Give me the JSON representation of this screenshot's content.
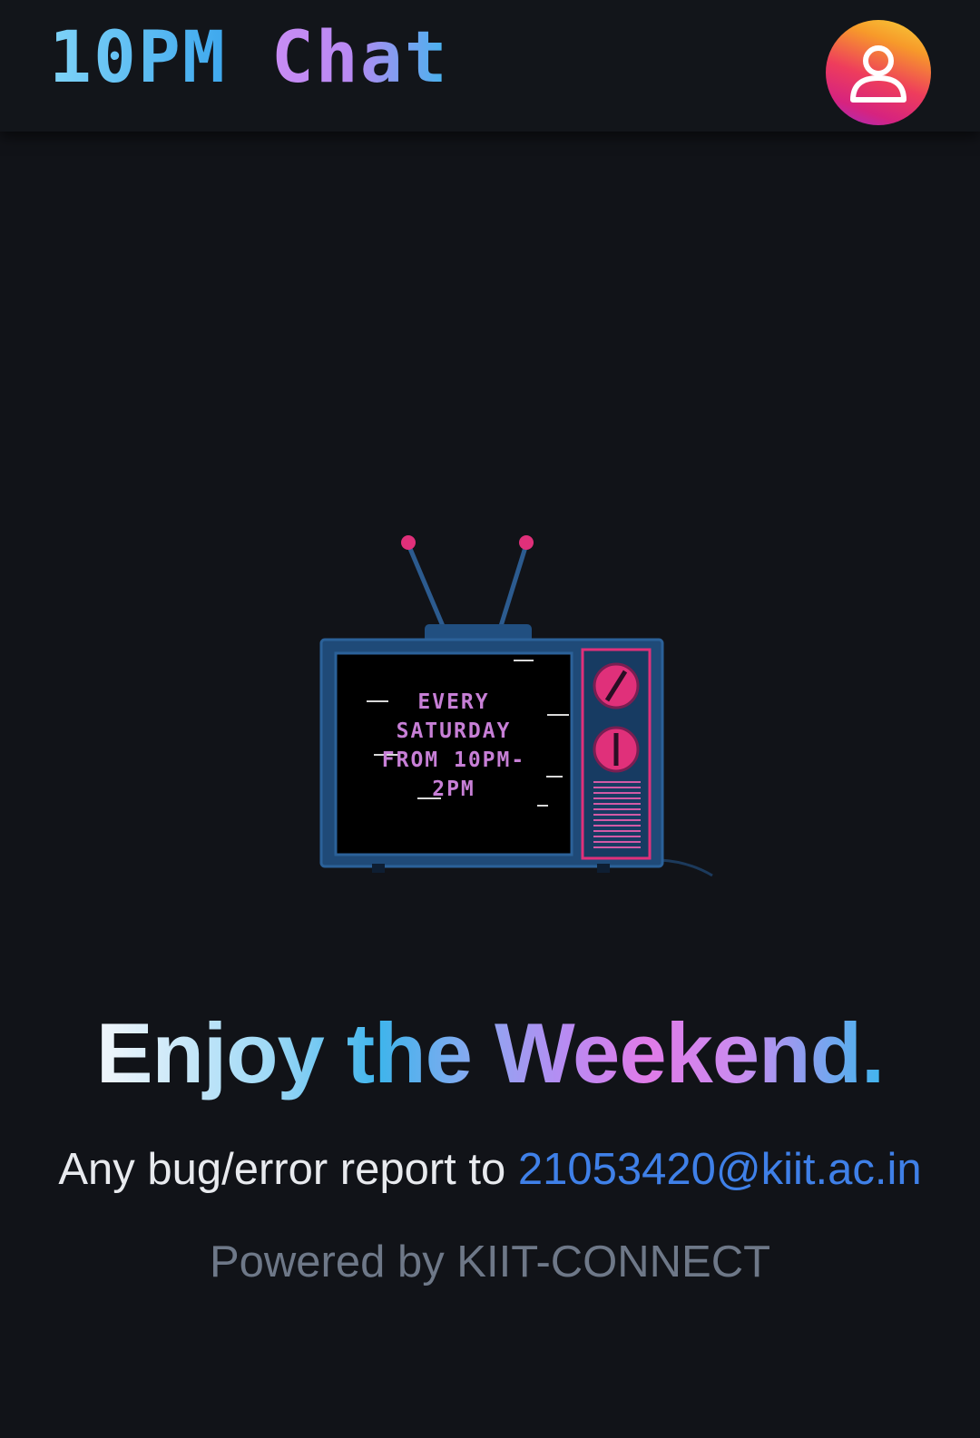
{
  "header": {
    "logo_part1": "10PM",
    "logo_part2": "Chat",
    "avatar_icon": "user-icon"
  },
  "tv": {
    "screen_line1": "EVERY",
    "screen_line2": "SATURDAY",
    "screen_line3": "FROM 10PM-",
    "screen_line4": "2PM"
  },
  "main": {
    "headline": "Enjoy the Weekend.",
    "report_prefix": "Any bug/error report to ",
    "report_email": "21053420@kiit.ac.in",
    "powered_by": "Powered by KIIT-CONNECT"
  },
  "colors": {
    "background": "#111318",
    "header_bg": "#12151a",
    "link": "#3f80e8",
    "muted": "#6e7888",
    "tv_body": "#1f4a78",
    "tv_accent": "#e0307a",
    "screen_text": "#c77fd6"
  }
}
